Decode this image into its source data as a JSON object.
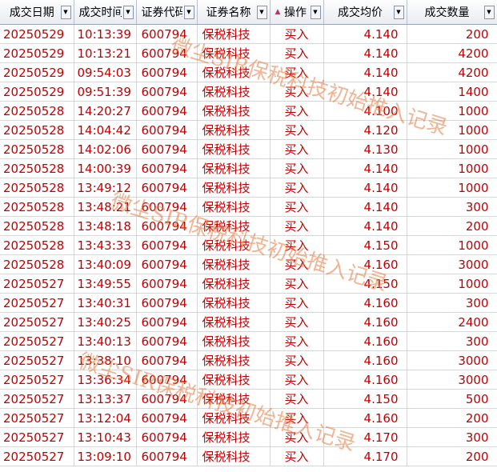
{
  "headers": [
    {
      "label": "成交日期"
    },
    {
      "label": "成交时间"
    },
    {
      "label": "证券代码"
    },
    {
      "label": "证券名称"
    },
    {
      "label": "操作",
      "sort": "▲"
    },
    {
      "label": "成交均价"
    },
    {
      "label": "成交数量"
    }
  ],
  "rows": [
    [
      "20250529",
      "10:13:39",
      "600794",
      "保税科技",
      "买入",
      "4.140",
      "200"
    ],
    [
      "20250529",
      "10:13:21",
      "600794",
      "保税科技",
      "买入",
      "4.140",
      "4200"
    ],
    [
      "20250529",
      "09:54:03",
      "600794",
      "保税科技",
      "买入",
      "4.140",
      "4200"
    ],
    [
      "20250529",
      "09:51:39",
      "600794",
      "保税科技",
      "买入",
      "4.140",
      "1400"
    ],
    [
      "20250528",
      "14:20:27",
      "600794",
      "保税科技",
      "买入",
      "4.100",
      "1000"
    ],
    [
      "20250528",
      "14:04:42",
      "600794",
      "保税科技",
      "买入",
      "4.120",
      "1000"
    ],
    [
      "20250528",
      "14:02:06",
      "600794",
      "保税科技",
      "买入",
      "4.130",
      "1000"
    ],
    [
      "20250528",
      "14:00:39",
      "600794",
      "保税科技",
      "买入",
      "4.140",
      "1000"
    ],
    [
      "20250528",
      "13:49:12",
      "600794",
      "保税科技",
      "买入",
      "4.140",
      "1000"
    ],
    [
      "20250528",
      "13:48:21",
      "600794",
      "保税科技",
      "买入",
      "4.140",
      "300"
    ],
    [
      "20250528",
      "13:48:18",
      "600794",
      "保税科技",
      "买入",
      "4.140",
      "200"
    ],
    [
      "20250528",
      "13:43:33",
      "600794",
      "保税科技",
      "买入",
      "4.150",
      "1000"
    ],
    [
      "20250528",
      "13:40:09",
      "600794",
      "保税科技",
      "买入",
      "4.160",
      "3000"
    ],
    [
      "20250527",
      "13:49:55",
      "600794",
      "保税科技",
      "买入",
      "4.150",
      "1000"
    ],
    [
      "20250527",
      "13:40:31",
      "600794",
      "保税科技",
      "买入",
      "4.160",
      "300"
    ],
    [
      "20250527",
      "13:40:25",
      "600794",
      "保税科技",
      "买入",
      "4.160",
      "2400"
    ],
    [
      "20250527",
      "13:40:13",
      "600794",
      "保税科技",
      "买入",
      "4.160",
      "300"
    ],
    [
      "20250527",
      "13:38:10",
      "600794",
      "保税科技",
      "买入",
      "4.160",
      "3000"
    ],
    [
      "20250527",
      "13:36:34",
      "600794",
      "保税科技",
      "买入",
      "4.160",
      "3000"
    ],
    [
      "20250527",
      "13:13:37",
      "600794",
      "保税科技",
      "买入",
      "4.150",
      "500"
    ],
    [
      "20250527",
      "13:12:04",
      "600794",
      "保税科技",
      "买入",
      "4.160",
      "200"
    ],
    [
      "20250527",
      "13:10:43",
      "600794",
      "保税科技",
      "买入",
      "4.170",
      "300"
    ],
    [
      "20250527",
      "13:09:10",
      "600794",
      "保税科技",
      "买入",
      "4.170",
      "200"
    ]
  ],
  "watermark": "微尘SIR保税科技初始推入记录",
  "colors": {
    "text": "#c00000",
    "watermark": "#e1783c"
  }
}
